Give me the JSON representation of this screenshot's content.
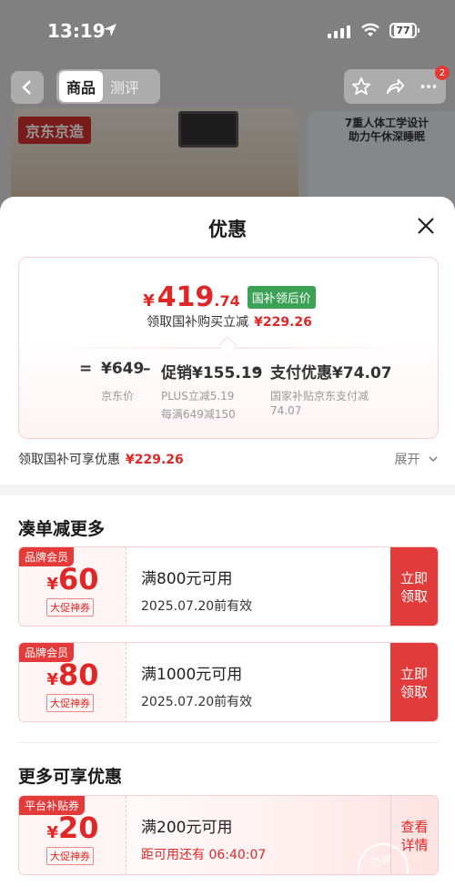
{
  "status": {
    "time": "13:19",
    "battery": "77"
  },
  "nav": {
    "tabs": [
      "商品",
      "测评"
    ],
    "active_tab": 0,
    "notification_count": "2"
  },
  "background": {
    "brand": "京东京造",
    "right_caption": "7重人体工学设计\n助力午休深睡眠"
  },
  "sheet": {
    "title": "优惠",
    "final_price": {
      "currency": "¥",
      "integer": "419",
      "decimal": ".74",
      "tag": "国补领后价"
    },
    "subline": {
      "text": "领取国补购买立减",
      "amount": "¥229.26"
    },
    "equation": {
      "equals": "=",
      "price": "¥649",
      "minus1": "–",
      "promo": "促销¥155.19",
      "minus2": "–",
      "payment": "支付优惠¥74.07"
    },
    "labels": {
      "price": "京东价",
      "promo_line1": "PLUS立减5.19",
      "promo_line2": "每满649减150",
      "payment_line1": "国家补贴京东支付减",
      "payment_line2": "74.07"
    },
    "national_subsidy": {
      "text": "领取国补可享优惠",
      "amount": "¥229.26",
      "expand": "展开"
    },
    "sections": {
      "more_discount": "凑单减更多",
      "more_offers": "更多可享优惠"
    },
    "coupons": [
      {
        "badge": "品牌会员",
        "currency": "¥",
        "amount": "60",
        "kind": "大促神券",
        "condition": "满800元可用",
        "validity": "2025.07.20前有效",
        "action_line1": "立即",
        "action_line2": "领取"
      },
      {
        "badge": "品牌会员",
        "currency": "¥",
        "amount": "80",
        "kind": "大促神券",
        "condition": "满1000元可用",
        "validity": "2025.07.20前有效",
        "action_line1": "立即",
        "action_line2": "领取"
      },
      {
        "badge": "平台补贴券",
        "currency": "¥",
        "amount": "20",
        "kind": "大促神券",
        "condition": "满200元可用",
        "validity": "距可用还有 06:40:07",
        "action_line1": "查看",
        "action_line2": "详情",
        "stamp": "已领"
      }
    ]
  },
  "colors": {
    "accent_red": "#e02727",
    "tag_green": "#3aa155"
  }
}
